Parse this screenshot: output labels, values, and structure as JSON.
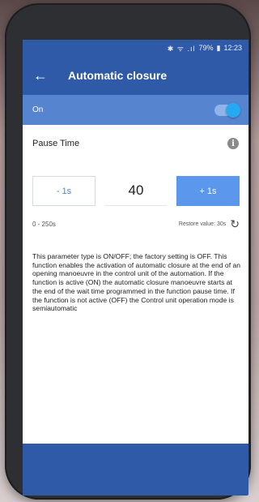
{
  "status_bar": {
    "icons": "✱ ᯤ .ıl",
    "battery": "79%",
    "time": "12:23"
  },
  "app_bar": {
    "back_icon": "←",
    "title": "Automatic closure"
  },
  "on_toggle": {
    "label": "On",
    "state": true
  },
  "parameter": {
    "name": "Pause Time",
    "info_icon": "i"
  },
  "stepper": {
    "decrement_label": "- 1s",
    "value": "40",
    "increment_label": "+ 1s"
  },
  "range": {
    "label": "0 - 250s",
    "restore_label": "Restore value: 30s",
    "restore_icon": "↻"
  },
  "description": "This parameter type is ON/OFF; the factory setting is OFF. This function enables the activation of automatic closure at the end of an opening manoeuvre in the control unit of the automation. If the function is active (ON) the automatic closure manoeuvre starts at the end of the wait time programmed in the function pause time. If the function is not active (OFF) the Control unit operation mode is semiautomatic",
  "colors": {
    "primary": "#2f5aa8",
    "toggle_row": "#5684cf",
    "accent_button": "#5b97ec",
    "toggle_knob": "#27a9f1"
  }
}
